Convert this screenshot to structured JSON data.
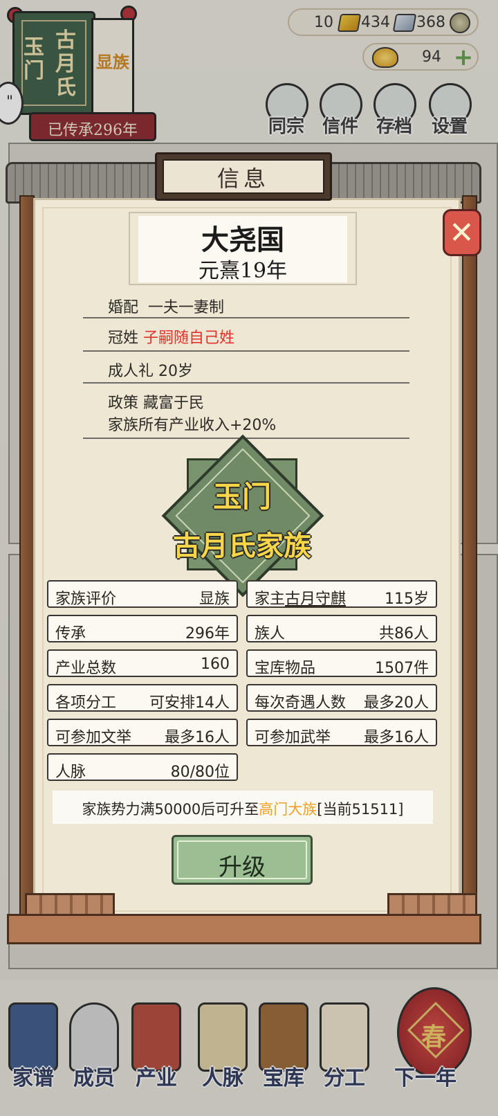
{
  "family": {
    "place": "玉门",
    "surname": "古月氏",
    "rank": "显族",
    "inherit_text": "已传承296年"
  },
  "resources": {
    "gold": "10",
    "silver": "434",
    "coins": "368",
    "gems": "94"
  },
  "top_menu": [
    {
      "label": "同宗",
      "icon": "book-icon"
    },
    {
      "label": "信件",
      "icon": "letter-icon"
    },
    {
      "label": "存档",
      "icon": "brush-icon"
    },
    {
      "label": "设置",
      "icon": "gear-icon"
    }
  ],
  "dialog": {
    "title": "信息",
    "nation": "大尧国",
    "era": "元熹19年",
    "rules": {
      "marriage_label": "婚配",
      "marriage_value": "一夫一妻制",
      "surname_label": "冠姓",
      "surname_value": "子嗣随自己姓",
      "adult_label": "成人礼",
      "adult_value": "20岁",
      "policy_label": "政策",
      "policy_value": "藏富于民",
      "policy_effect": "家族所有产业收入+20%"
    },
    "emblem": {
      "line1": "玉门",
      "line2": "古月氏家族"
    },
    "stats": {
      "rating_label": "家族评价",
      "rating_value": "显族",
      "head_label": "家主",
      "head_name": "古月守麒",
      "head_age": "115岁",
      "inherit_label": "传承",
      "inherit_value": "296年",
      "members_label": "族人",
      "members_value": "共86人",
      "industry_label": "产业总数",
      "industry_value": "160",
      "treasury_label": "宝库物品",
      "treasury_value": "1507件",
      "labor_label": "各项分工",
      "labor_value": "可安排14人",
      "encounter_label": "每次奇遇人数",
      "encounter_value": "最多20人",
      "civil_label": "可参加文举",
      "civil_value": "最多16人",
      "military_label": "可参加武举",
      "military_value": "最多16人",
      "network_label": "人脉",
      "network_value": "80/80位"
    },
    "notice": {
      "prefix": "家族势力满50000后可升至",
      "target": "高门大族",
      "suffix": "[当前51511]"
    },
    "upgrade_label": "升级",
    "close_label": "✕"
  },
  "bottom_nav": [
    {
      "label": "家谱"
    },
    {
      "label": "成员"
    },
    {
      "label": "产业"
    },
    {
      "label": "人脉"
    },
    {
      "label": "宝库"
    },
    {
      "label": "分工"
    },
    {
      "label": "下一年"
    }
  ],
  "lantern_char": "春",
  "colors": {
    "accent_red": "#e2312d",
    "accent_orange": "#f0a025",
    "emblem_green": "#6f8a64",
    "button_green": "#9bbf92"
  }
}
